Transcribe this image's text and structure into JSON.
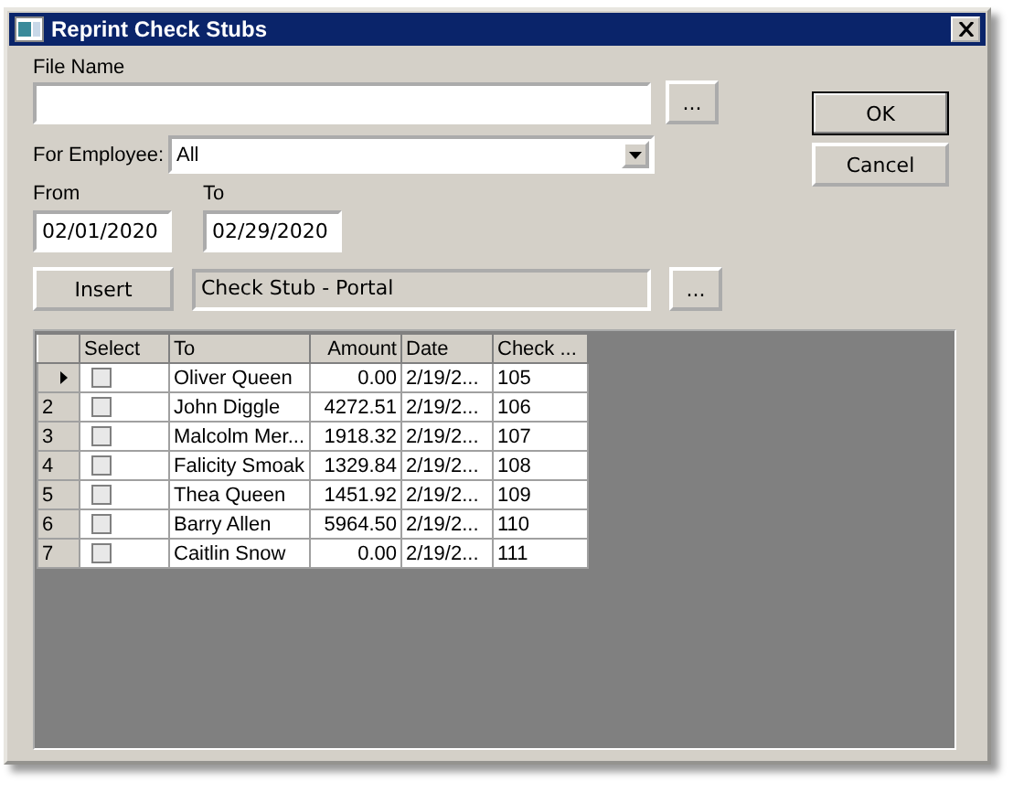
{
  "window": {
    "title": "Reprint Check Stubs"
  },
  "file_name": {
    "label": "File Name",
    "browse": "..."
  },
  "employee": {
    "label": "For Employee:",
    "value": "All"
  },
  "from": {
    "label": "From",
    "value": "02/01/2020"
  },
  "to": {
    "label": "To",
    "value": "02/29/2020"
  },
  "insert": {
    "button": "Insert",
    "template": "Check Stub - Portal",
    "browse": "..."
  },
  "buttons": [
    "OK",
    "Cancel"
  ],
  "table": {
    "columns": [
      "Select",
      "To",
      "Amount",
      "Date",
      "Check ..."
    ],
    "rows": [
      {
        "current": true,
        "select": false,
        "to": "Oliver Queen",
        "amount": "0.00",
        "date": "2/19/2...",
        "check": "105"
      },
      {
        "number": "2",
        "current": false,
        "select": false,
        "to": "John Diggle",
        "amount": "4272.51",
        "date": "2/19/2...",
        "check": "106"
      },
      {
        "number": "3",
        "current": false,
        "select": false,
        "to": "Malcolm Mer...",
        "amount": "1918.32",
        "date": "2/19/2...",
        "check": "107"
      },
      {
        "number": "4",
        "current": false,
        "select": false,
        "to": "Falicity Smoak",
        "amount": "1329.84",
        "date": "2/19/2...",
        "check": "108"
      },
      {
        "number": "5",
        "current": false,
        "select": false,
        "to": "Thea Queen",
        "amount": "1451.92",
        "date": "2/19/2...",
        "check": "109"
      },
      {
        "number": "6",
        "current": false,
        "select": false,
        "to": "Barry Allen",
        "amount": "5964.50",
        "date": "2/19/2...",
        "check": "110"
      },
      {
        "number": "7",
        "current": false,
        "select": false,
        "to": "Caitlin Snow",
        "amount": "0.00",
        "date": "2/19/2...",
        "check": "111"
      }
    ]
  }
}
